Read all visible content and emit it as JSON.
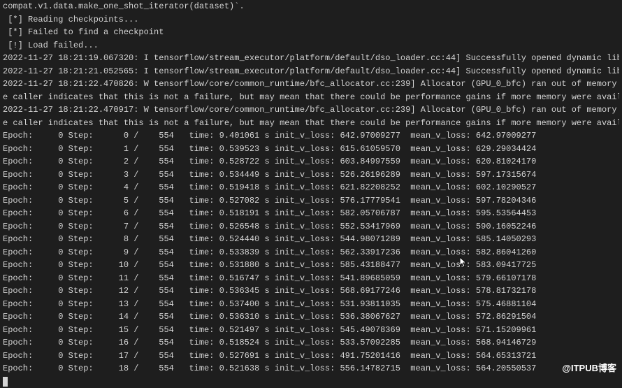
{
  "header_lines": [
    "compat.v1.data.make_one_shot_iterator(dataset)`.",
    " [*] Reading checkpoints...",
    " [*] Failed to find a checkpoint",
    " [!] Load failed..."
  ],
  "log_lines": [
    "2022-11-27 18:21:19.067320: I tensorflow/stream_executor/platform/default/dso_loader.cc:44] Successfully opened dynamic library libc",
    "2022-11-27 18:21:21.052565: I tensorflow/stream_executor/platform/default/dso_loader.cc:44] Successfully opened dynamic library libc",
    "2022-11-27 18:21:22.470826: W tensorflow/core/common_runtime/bfc_allocator.cc:239] Allocator (GPU_0_bfc) ran out of memory trying to",
    "e caller indicates that this is not a failure, but may mean that there could be performance gains if more memory were available.",
    "2022-11-27 18:21:22.470917: W tensorflow/core/common_runtime/bfc_allocator.cc:239] Allocator (GPU_0_bfc) ran out of memory trying to",
    "e caller indicates that this is not a failure, but may mean that there could be performance gains if more memory were available."
  ],
  "epochs": [
    {
      "epoch": 0,
      "step": 0,
      "total": 554,
      "time": "9.401061",
      "init_v_loss": "642.97009277",
      "mean_v_loss": "642.97009277"
    },
    {
      "epoch": 0,
      "step": 1,
      "total": 554,
      "time": "0.539523",
      "init_v_loss": "615.61059570",
      "mean_v_loss": "629.29034424"
    },
    {
      "epoch": 0,
      "step": 2,
      "total": 554,
      "time": "0.528722",
      "init_v_loss": "603.84997559",
      "mean_v_loss": "620.81024170"
    },
    {
      "epoch": 0,
      "step": 3,
      "total": 554,
      "time": "0.534449",
      "init_v_loss": "526.26196289",
      "mean_v_loss": "597.17315674"
    },
    {
      "epoch": 0,
      "step": 4,
      "total": 554,
      "time": "0.519418",
      "init_v_loss": "621.82208252",
      "mean_v_loss": "602.10290527"
    },
    {
      "epoch": 0,
      "step": 5,
      "total": 554,
      "time": "0.527082",
      "init_v_loss": "576.17779541",
      "mean_v_loss": "597.78204346"
    },
    {
      "epoch": 0,
      "step": 6,
      "total": 554,
      "time": "0.518191",
      "init_v_loss": "582.05706787",
      "mean_v_loss": "595.53564453"
    },
    {
      "epoch": 0,
      "step": 7,
      "total": 554,
      "time": "0.526548",
      "init_v_loss": "552.53417969",
      "mean_v_loss": "590.16052246"
    },
    {
      "epoch": 0,
      "step": 8,
      "total": 554,
      "time": "0.524440",
      "init_v_loss": "544.98071289",
      "mean_v_loss": "585.14050293"
    },
    {
      "epoch": 0,
      "step": 9,
      "total": 554,
      "time": "0.533839",
      "init_v_loss": "562.33917236",
      "mean_v_loss": "582.86041260"
    },
    {
      "epoch": 0,
      "step": 10,
      "total": 554,
      "time": "0.531880",
      "init_v_loss": "585.43188477",
      "mean_v_loss": "583.09417725"
    },
    {
      "epoch": 0,
      "step": 11,
      "total": 554,
      "time": "0.516747",
      "init_v_loss": "541.89685059",
      "mean_v_loss": "579.66107178"
    },
    {
      "epoch": 0,
      "step": 12,
      "total": 554,
      "time": "0.536345",
      "init_v_loss": "568.69177246",
      "mean_v_loss": "578.81732178"
    },
    {
      "epoch": 0,
      "step": 13,
      "total": 554,
      "time": "0.537400",
      "init_v_loss": "531.93811035",
      "mean_v_loss": "575.46881104"
    },
    {
      "epoch": 0,
      "step": 14,
      "total": 554,
      "time": "0.536310",
      "init_v_loss": "536.38067627",
      "mean_v_loss": "572.86291504"
    },
    {
      "epoch": 0,
      "step": 15,
      "total": 554,
      "time": "0.521497",
      "init_v_loss": "545.49078369",
      "mean_v_loss": "571.15209961"
    },
    {
      "epoch": 0,
      "step": 16,
      "total": 554,
      "time": "0.518524",
      "init_v_loss": "533.57092285",
      "mean_v_loss": "568.94146729"
    },
    {
      "epoch": 0,
      "step": 17,
      "total": 554,
      "time": "0.527691",
      "init_v_loss": "491.75201416",
      "mean_v_loss": "564.65313721"
    },
    {
      "epoch": 0,
      "step": 18,
      "total": 554,
      "time": "0.521638",
      "init_v_loss": "556.14782715",
      "mean_v_loss": "564.20550537"
    }
  ],
  "watermark": "@ITPUB博客"
}
